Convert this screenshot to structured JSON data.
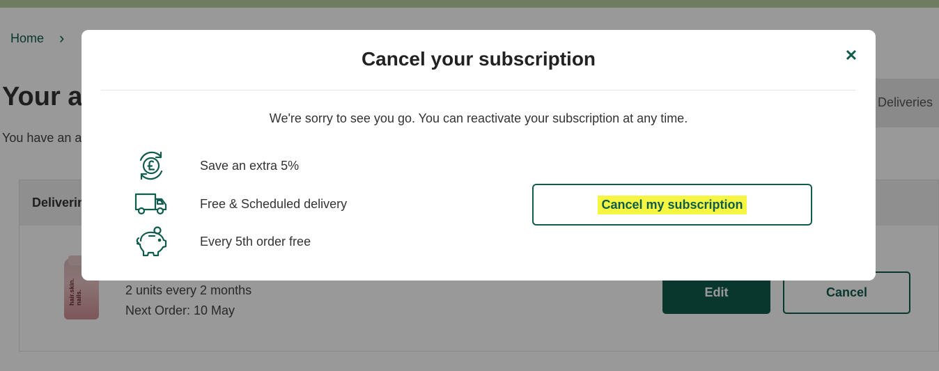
{
  "background": {
    "breadcrumb": {
      "home": "Home"
    },
    "page_title": "Your a",
    "page_subtitle": "You have an a",
    "tab_deliveries": "Deliveries",
    "card": {
      "header": "Deliverin",
      "product_label": "hair.skin. nails.",
      "units": "2 units every 2 months",
      "next_order": "Next Order: 10 May",
      "edit_label": "Edit",
      "cancel_label": "Cancel"
    }
  },
  "modal": {
    "title": "Cancel your subscription",
    "close_symbol": "✕",
    "message": "We're sorry to see you go. You can reactivate your subscription at any time.",
    "benefits": [
      {
        "icon": "pound-refresh-icon",
        "text": "Save an extra 5%"
      },
      {
        "icon": "delivery-truck-icon",
        "text": "Free & Scheduled delivery"
      },
      {
        "icon": "piggy-bank-icon",
        "text": "Every 5th order free"
      }
    ],
    "cancel_button_label": "Cancel my subscription"
  },
  "colors": {
    "brand": "#0f5c4d",
    "highlight": "#f5f542",
    "topbar": "#b9cfa4"
  }
}
